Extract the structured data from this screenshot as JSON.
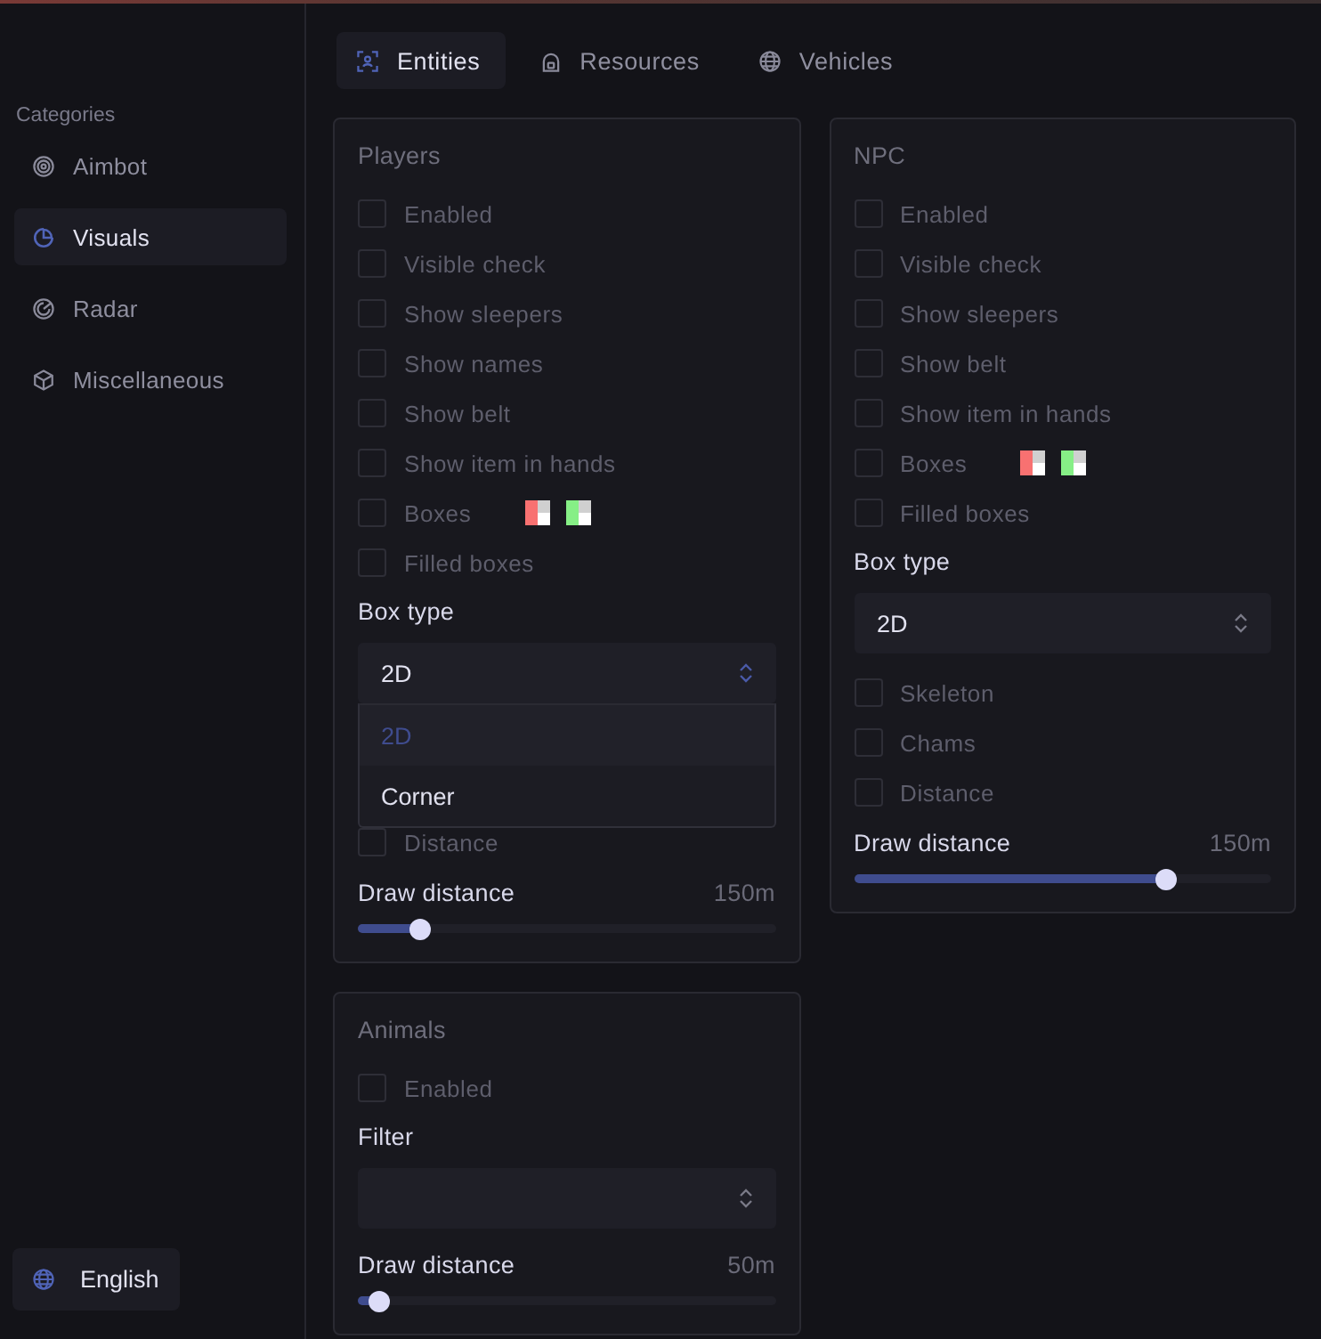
{
  "sidebar": {
    "heading": "Categories",
    "items": [
      {
        "label": "Aimbot",
        "selected": false
      },
      {
        "label": "Visuals",
        "selected": true
      },
      {
        "label": "Radar",
        "selected": false
      },
      {
        "label": "Miscellaneous",
        "selected": false
      }
    ],
    "language": "English"
  },
  "tabs": [
    {
      "label": "Entities",
      "selected": true
    },
    {
      "label": "Resources",
      "selected": false
    },
    {
      "label": "Vehicles",
      "selected": false
    }
  ],
  "panels": [
    {
      "title": "Players",
      "items": [
        {
          "kind": "checkbox",
          "label": "Enabled",
          "checked": false
        },
        {
          "kind": "checkbox",
          "label": "Visible check",
          "checked": false
        },
        {
          "kind": "checkbox",
          "label": "Show sleepers",
          "checked": false
        },
        {
          "kind": "checkbox",
          "label": "Show names",
          "checked": false
        },
        {
          "kind": "checkbox",
          "label": "Show belt",
          "checked": false
        },
        {
          "kind": "checkbox",
          "label": "Show item in hands",
          "checked": false
        },
        {
          "kind": "checkbox",
          "label": "Boxes",
          "checked": false,
          "colors": [
            {
              "color": "#f87171"
            },
            {
              "color": "#86ef86"
            }
          ]
        },
        {
          "kind": "checkbox",
          "label": "Filled boxes",
          "checked": false
        },
        {
          "kind": "select",
          "label": "Box type",
          "value": "2D",
          "expanded": true,
          "options": [
            {
              "label": "2D",
              "selected": true
            },
            {
              "label": "Corner",
              "selected": false
            }
          ]
        },
        {
          "kind": "checkbox",
          "label": "Distance",
          "checked": false
        },
        {
          "kind": "slider",
          "label": "Draw distance",
          "reading": "150m",
          "level": 0.15
        }
      ]
    },
    {
      "title": "NPC",
      "items": [
        {
          "kind": "checkbox",
          "label": "Enabled",
          "checked": false
        },
        {
          "kind": "checkbox",
          "label": "Visible check",
          "checked": false
        },
        {
          "kind": "checkbox",
          "label": "Show sleepers",
          "checked": false
        },
        {
          "kind": "checkbox",
          "label": "Show belt",
          "checked": false
        },
        {
          "kind": "checkbox",
          "label": "Show item in hands",
          "checked": false
        },
        {
          "kind": "checkbox",
          "label": "Boxes",
          "checked": false,
          "colors": [
            {
              "color": "#f87171"
            },
            {
              "color": "#86ef86"
            }
          ]
        },
        {
          "kind": "checkbox",
          "label": "Filled boxes",
          "checked": false
        },
        {
          "kind": "select",
          "label": "Box type",
          "value": "2D",
          "expanded": false
        },
        {
          "kind": "checkbox",
          "label": "Skeleton",
          "checked": false
        },
        {
          "kind": "checkbox",
          "label": "Chams",
          "checked": false
        },
        {
          "kind": "checkbox",
          "label": "Distance",
          "checked": false
        },
        {
          "kind": "slider",
          "label": "Draw distance",
          "reading": "150m",
          "level": 0.75
        }
      ]
    },
    {
      "title": "Animals",
      "items": [
        {
          "kind": "checkbox",
          "label": "Enabled",
          "checked": false
        },
        {
          "kind": "select",
          "label": "Filter",
          "expanded": false
        },
        {
          "kind": "slider",
          "label": "Draw distance",
          "reading": "50m",
          "level": 0.05
        }
      ]
    }
  ]
}
